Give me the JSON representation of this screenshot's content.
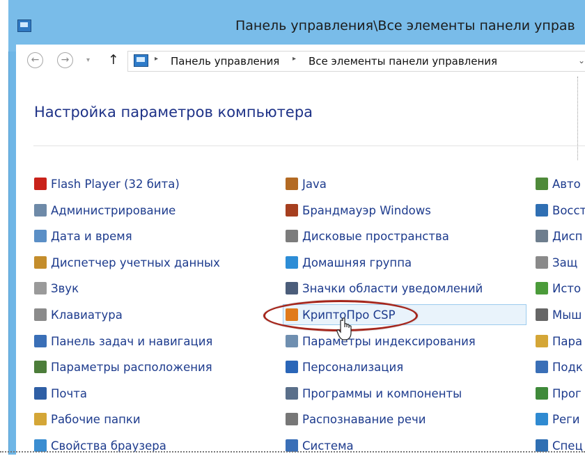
{
  "window": {
    "title": "Панель управления\\Все элементы панели управ"
  },
  "navigation": {
    "back_icon": "arrow-left-icon",
    "forward_icon": "arrow-right-icon",
    "up_icon": "arrow-up-icon",
    "back_glyph": "←",
    "forward_glyph": "→",
    "recent_glyph": "▾",
    "up_glyph": "↑",
    "separator_glyph": "▸",
    "dropdown_glyph": "⌄",
    "breadcrumbs": [
      "Панель управления",
      "Все элементы панели управления"
    ]
  },
  "page": {
    "heading": "Настройка параметров компьютера"
  },
  "items": {
    "col1": [
      {
        "label": "Flash Player (32 бита)",
        "icon": "flash-icon",
        "color": "#c9221a"
      },
      {
        "label": "Администрирование",
        "icon": "admin-tools-icon",
        "color": "#6e8aa8"
      },
      {
        "label": "Дата и время",
        "icon": "clock-icon",
        "color": "#5b8fc6"
      },
      {
        "label": "Диспетчер учетных данных",
        "icon": "credential-manager-icon",
        "color": "#c48d2c"
      },
      {
        "label": "Звук",
        "icon": "speaker-icon",
        "color": "#9a9a9a"
      },
      {
        "label": "Клавиатура",
        "icon": "keyboard-icon",
        "color": "#8b8b8b"
      },
      {
        "label": "Панель задач и навигация",
        "icon": "taskbar-icon",
        "color": "#3a6fb7"
      },
      {
        "label": "Параметры расположения",
        "icon": "location-icon",
        "color": "#4c7d3a"
      },
      {
        "label": "Почта",
        "icon": "mail-icon",
        "color": "#2f5fa5"
      },
      {
        "label": "Рабочие папки",
        "icon": "work-folders-icon",
        "color": "#d4a637"
      },
      {
        "label": "Свойства браузера",
        "icon": "internet-options-icon",
        "color": "#3a8dd1"
      }
    ],
    "col2": [
      {
        "label": "Java",
        "icon": "java-icon",
        "color": "#b36a23"
      },
      {
        "label": "Брандмауэр Windows",
        "icon": "firewall-icon",
        "color": "#a63f1f"
      },
      {
        "label": "Дисковые пространства",
        "icon": "storage-spaces-icon",
        "color": "#7c7c7c"
      },
      {
        "label": "Домашняя группа",
        "icon": "homegroup-icon",
        "color": "#2d8dd6"
      },
      {
        "label": "Значки области уведомлений",
        "icon": "notification-icons-icon",
        "color": "#4b5d7a"
      },
      {
        "label": "КриптоПро CSP",
        "icon": "cryptopro-icon",
        "color": "#e07a1b"
      },
      {
        "label": "Параметры индексирования",
        "icon": "indexing-icon",
        "color": "#6f8fb0"
      },
      {
        "label": "Персонализация",
        "icon": "personalization-icon",
        "color": "#2a66b8"
      },
      {
        "label": "Программы и компоненты",
        "icon": "programs-icon",
        "color": "#5a6f8a"
      },
      {
        "label": "Распознавание речи",
        "icon": "microphone-icon",
        "color": "#777777"
      },
      {
        "label": "Система",
        "icon": "system-icon",
        "color": "#3a6fb7"
      }
    ],
    "col3": [
      {
        "label": "Авто",
        "icon": "autoplay-icon",
        "color": "#4f8a3a"
      },
      {
        "label": "Восст",
        "icon": "recovery-icon",
        "color": "#2f6fb3"
      },
      {
        "label": "Дисп",
        "icon": "device-manager-icon",
        "color": "#6e7e8e"
      },
      {
        "label": "Защ",
        "icon": "bitlocker-icon",
        "color": "#8a8a8a"
      },
      {
        "label": "Исто",
        "icon": "file-history-icon",
        "color": "#4b9b3a"
      },
      {
        "label": "Мыш",
        "icon": "mouse-icon",
        "color": "#666666"
      },
      {
        "label": "Пара",
        "icon": "folder-options-icon",
        "color": "#d4a637"
      },
      {
        "label": "Подк",
        "icon": "connect-icon",
        "color": "#3a6fb7"
      },
      {
        "label": "Прог",
        "icon": "default-programs-icon",
        "color": "#3f8a3a"
      },
      {
        "label": "Реги",
        "icon": "region-icon",
        "color": "#2f8ad1"
      },
      {
        "label": "Спец",
        "icon": "ease-of-access-icon",
        "color": "#2f6fb3"
      }
    ]
  },
  "highlighted_item": "КриптоПро CSP",
  "colors": {
    "link": "#1d3b8d",
    "heading": "#1e3287",
    "title_bar": "#79bce9",
    "annotation": "#a5261c"
  }
}
